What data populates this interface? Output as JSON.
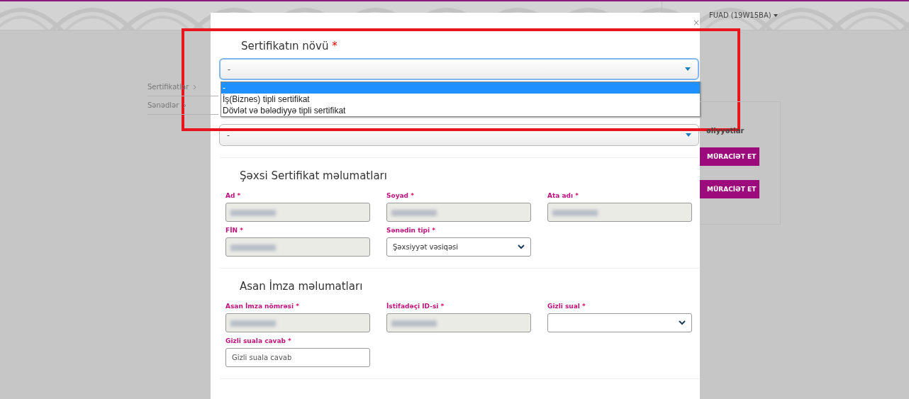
{
  "header": {
    "user_menu": "FUAD (19W15BA)"
  },
  "sidebar": {
    "items": [
      {
        "label": "Sertifikatlar"
      },
      {
        "label": "Sənədlər"
      }
    ]
  },
  "side_card": {
    "title": "əliyyətlar",
    "buttons": [
      "MÜRACİƏT ET",
      "MÜRACİƏT ET"
    ]
  },
  "modal": {
    "close": "×",
    "certificate_type": {
      "label": "Sertifikatın növü",
      "mark": "*",
      "value": "-",
      "expanded": true,
      "options": [
        {
          "label": "-",
          "selected": true
        },
        {
          "label": "İş(Biznes) tipli sertifikat",
          "selected": false
        },
        {
          "label": "Dövlət və bələdiyyə tipli sertifikat",
          "selected": false
        }
      ]
    },
    "second_select": {
      "value": "-"
    },
    "sections": [
      {
        "title": "Şəxsi Sertifikat məlumatları",
        "fields": [
          {
            "label": "Ad",
            "mark": "*",
            "kind": "blurred"
          },
          {
            "label": "Soyad",
            "mark": "*",
            "kind": "blurred"
          },
          {
            "label": "Ata adı",
            "mark": "*",
            "kind": "blurred"
          },
          {
            "label": "FİN",
            "mark": "*",
            "kind": "blurred"
          },
          {
            "label": "Sənədin tipi",
            "mark": "*",
            "kind": "select",
            "value": "Şəxsiyyət vəsiqəsi"
          }
        ]
      },
      {
        "title": "Asan İmza məlumatları",
        "fields": [
          {
            "label": "Asan İmza nömrəsi",
            "mark": "*",
            "kind": "blurred"
          },
          {
            "label": "İstifadəçi ID-si",
            "mark": "*",
            "kind": "blurred"
          },
          {
            "label": "Gizli sual",
            "mark": "*",
            "kind": "select"
          },
          {
            "label": "Gizli suala cavab",
            "mark": "*",
            "kind": "input",
            "placeholder": "Gizli suala cavab"
          }
        ]
      }
    ]
  },
  "annotation": {
    "kind": "highlight-box"
  }
}
